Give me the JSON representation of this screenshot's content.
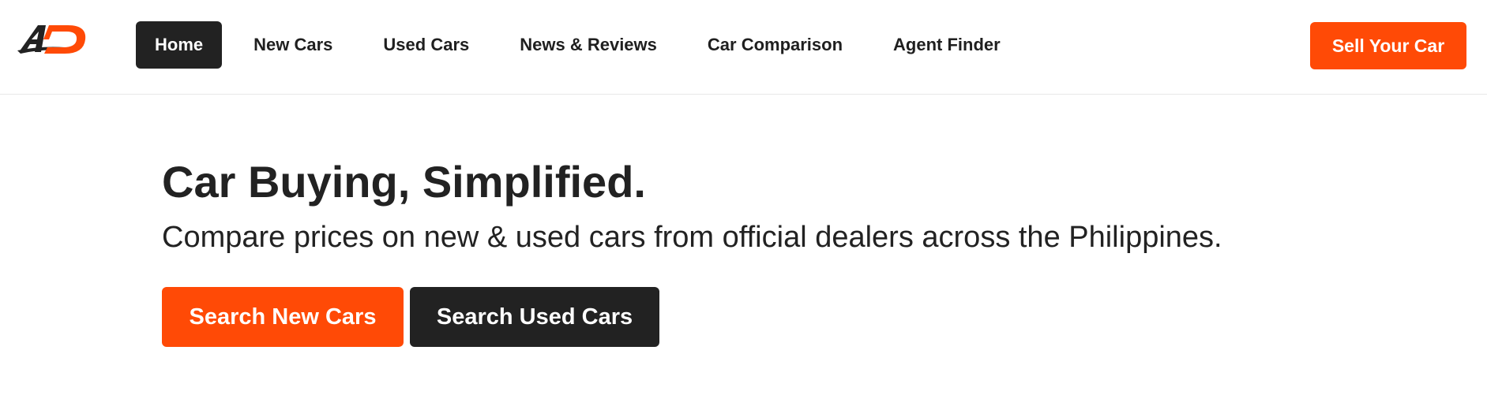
{
  "brand": {
    "logo_icon": "ad-logo-icon",
    "logo_text": "AD",
    "colors": {
      "accent": "#ff4a06",
      "dark": "#222222",
      "text": "#1f1f1f",
      "background": "#ffffff",
      "divider": "#e8e8e8"
    }
  },
  "nav": {
    "items": [
      {
        "label": "Home",
        "active": true
      },
      {
        "label": "New Cars",
        "active": false
      },
      {
        "label": "Used Cars",
        "active": false
      },
      {
        "label": "News & Reviews",
        "active": false
      },
      {
        "label": "Car Comparison",
        "active": false
      },
      {
        "label": "Agent Finder",
        "active": false
      }
    ],
    "cta_label": "Sell Your Car"
  },
  "hero": {
    "title": "Car Buying, Simplified.",
    "subtitle": "Compare prices on new & used cars from official dealers across the Philippines.",
    "primary_button": "Search New Cars",
    "secondary_button": "Search Used Cars"
  }
}
